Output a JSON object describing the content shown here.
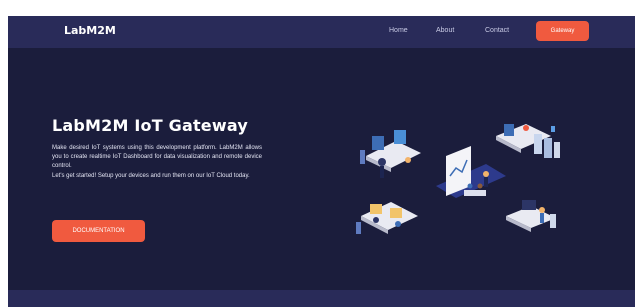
{
  "nav": {
    "brand": "LabM2M",
    "links": [
      "Home",
      "About",
      "Contact"
    ],
    "cta_label": "Gateway"
  },
  "hero": {
    "title": "LabM2M IoT Gateway",
    "paragraph1": "Make desired IoT systems using this development platform. LabM2M allows you to create realtime IoT Dashboard for data visualization and remote device control.",
    "paragraph2": "Let's get started! Setup your devices and run them on our IoT Cloud today.",
    "button_label": "DOCUMENTATION"
  },
  "colors": {
    "background": "#1b1d3c",
    "navbar": "#292b59",
    "accent": "#f05a3f",
    "text": "#ffffff"
  }
}
